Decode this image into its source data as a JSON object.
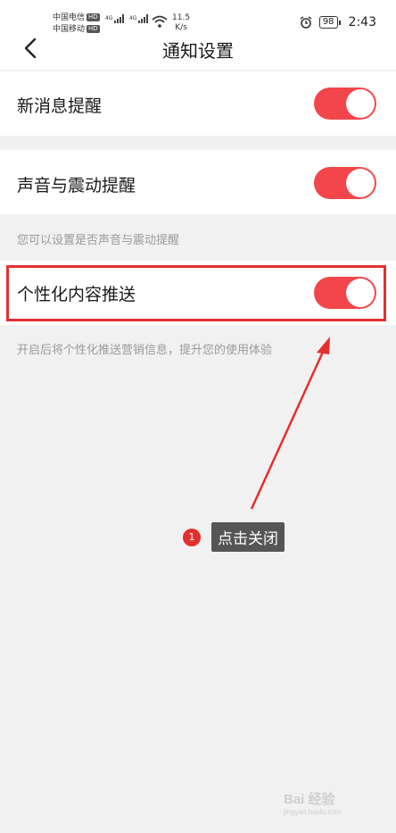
{
  "status": {
    "carrier1": "中国电信",
    "carrier2": "中国移动",
    "hd": "HD",
    "net1": "4G",
    "net2": "4G",
    "speed_value": "11.5",
    "speed_unit": "K/s",
    "battery": "98",
    "time": "2:43",
    "icons": [
      "signal-icon",
      "wifi-icon",
      "alarm-icon",
      "battery-icon"
    ]
  },
  "nav": {
    "title": "通知设置",
    "back_icon": "chevron-left-icon"
  },
  "settings": [
    {
      "label": "新消息提醒",
      "enabled": true
    },
    {
      "label": "声音与震动提醒",
      "enabled": true,
      "hint": "您可以设置是否声音与震动提醒"
    },
    {
      "label": "个性化内容推送",
      "enabled": true,
      "hint": "开启后将个性化推送营销信息，提升您的使用体验"
    }
  ],
  "annotation": {
    "step": "1",
    "text": "点击关闭"
  },
  "colors": {
    "accent": "#f2464a",
    "highlight": "#e3302f",
    "background": "#f1f1f1"
  },
  "watermark": {
    "main": "Bai 经验",
    "sub": "jingyan.baidu.com"
  }
}
